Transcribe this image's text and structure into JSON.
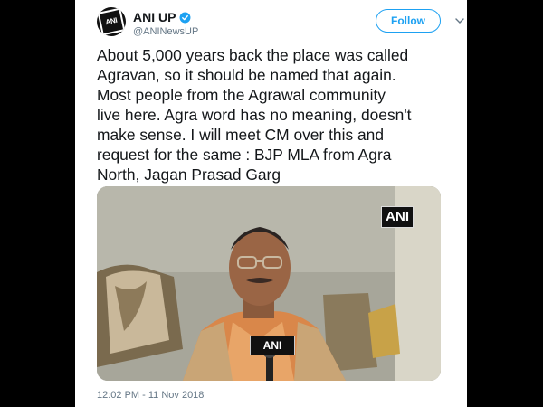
{
  "tweet": {
    "display_name": "ANI UP",
    "handle": "@ANINewsUP",
    "avatar_text": "ANI",
    "follow_label": "Follow",
    "text": "About 5,000 years back the place was called\nAgravan, so it should be named that again.\nMost people from the Agrawal community\nlive here. Agra word has no meaning, doesn't\nmake sense. I will meet CM over this and\nrequest for the same : BJP MLA from Agra\nNorth, Jagan Prasad Garg",
    "timestamp": "12:02 PM - 11 Nov 2018"
  },
  "media": {
    "watermark": "ANI",
    "mic_label": "ANI"
  },
  "colors": {
    "accent": "#1da1f2",
    "text": "#14171a",
    "muted": "#657786",
    "background": "#000000"
  },
  "icons": {
    "verified": "verified-badge-icon",
    "menu": "chevron-down-icon"
  }
}
